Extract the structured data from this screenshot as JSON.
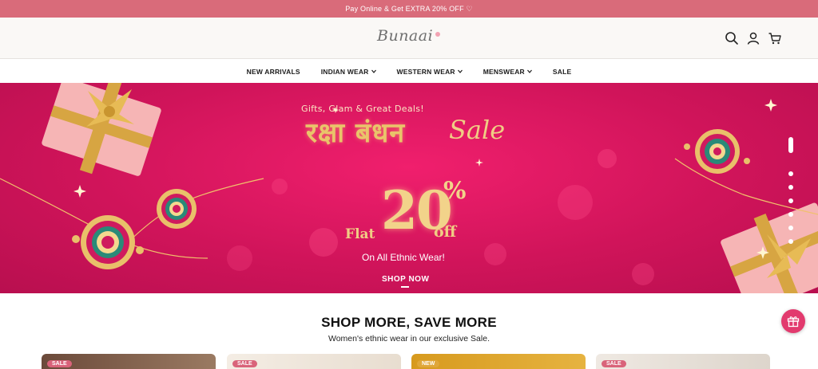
{
  "announcement": "Pay Online & Get EXTRA 20% OFF ♡",
  "header": {
    "logo": "Bunaai",
    "icons": [
      "search-icon",
      "account-icon",
      "cart-icon"
    ]
  },
  "nav": {
    "items": [
      {
        "label": "NEW ARRIVALS",
        "has_dropdown": false
      },
      {
        "label": "INDIAN WEAR",
        "has_dropdown": true
      },
      {
        "label": "WESTERN WEAR",
        "has_dropdown": true
      },
      {
        "label": "MENSWEAR",
        "has_dropdown": true
      },
      {
        "label": "SALE",
        "has_dropdown": false
      }
    ]
  },
  "hero": {
    "tagline": "Gifts, Glam & Great Deals!",
    "title_hindi": "रक्षा बंधन",
    "title_sale": "Sale",
    "flat": "Flat",
    "discount": "20",
    "percent": "%",
    "off": "off",
    "subtitle": "On All Ethnic Wear!",
    "cta": "SHOP NOW",
    "slide_count": 7,
    "active_slide": 1
  },
  "section": {
    "title": "SHOP MORE, SAVE MORE",
    "subtitle": "Women's ethnic wear in our exclusive Sale."
  },
  "cards": [
    {
      "badge": "SALE"
    },
    {
      "badge": "SALE"
    },
    {
      "badge": "NEW"
    },
    {
      "badge": "SALE"
    }
  ],
  "colors": {
    "announcement_bg": "#d96b7a",
    "hero_bg": "#d0145a",
    "gold": "#f0cd84",
    "sale_badge": "#d9637a",
    "new_badge": "#e0a73a",
    "gift_fab": "#e23a6e"
  }
}
